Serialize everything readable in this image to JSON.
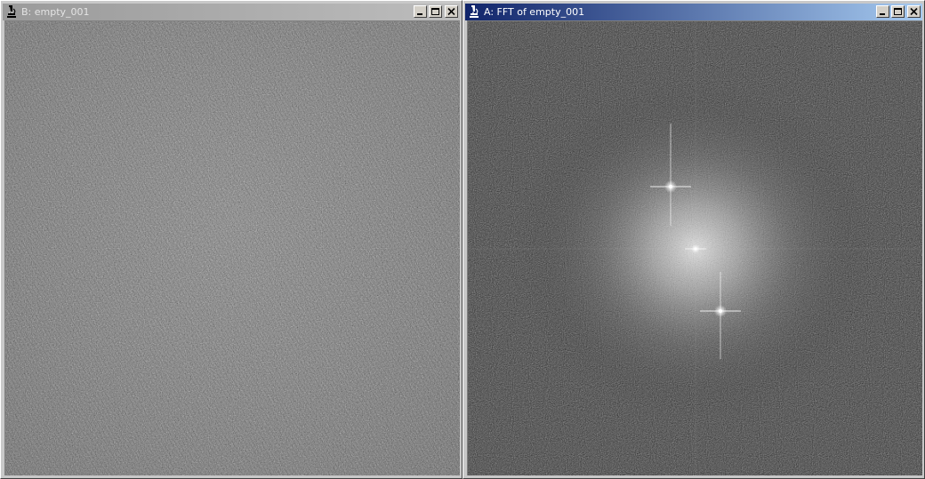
{
  "windows": {
    "left": {
      "title": "B: empty_001",
      "state": "inactive",
      "image": "grayscale-noise-image"
    },
    "right": {
      "title": "A: FFT of empty_001",
      "state": "active",
      "image": "fft-power-spectrum-image"
    }
  },
  "controls": {
    "minimize_icon": "minimize-icon",
    "maximize_icon": "maximize-icon",
    "close_icon": "close-icon"
  },
  "colors": {
    "active_title_start": "#10246a",
    "active_title_end": "#a6caf0",
    "inactive_title_start": "#9a9a9a",
    "inactive_title_end": "#bdbdbd",
    "image_left_bg": "#7a7a7a",
    "image_right_bg": "#3a3a3a"
  }
}
